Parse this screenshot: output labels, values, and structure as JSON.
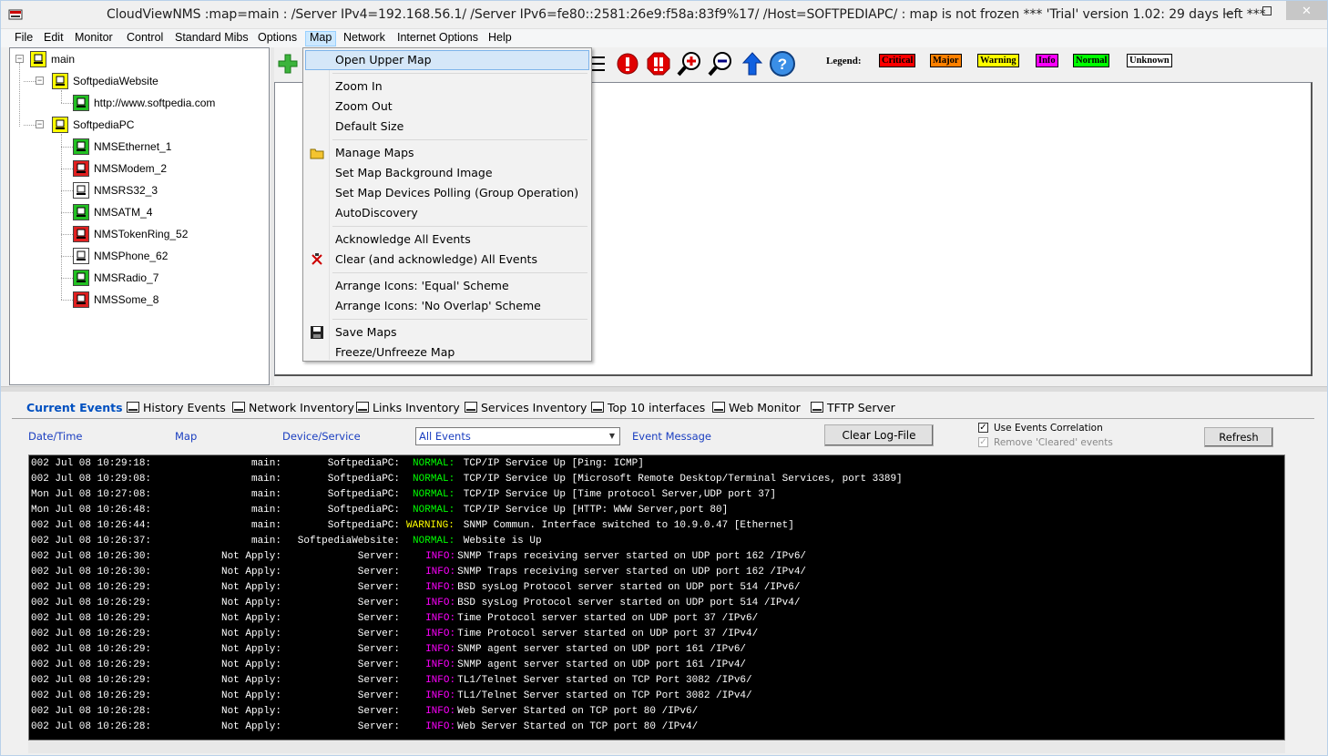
{
  "window": {
    "title": "CloudViewNMS :map=main :  /Server IPv4=192.168.56.1/ /Server IPv6=fe80::2581:26e9:f58a:83f9%17/ /Host=SOFTPEDIAPC/  : map is not frozen        *** 'Trial' version 1.02: 29 days left ***",
    "close_glyph": "✕"
  },
  "menubar": [
    "File",
    "Edit",
    "Monitor",
    "Control",
    "Standard Mibs",
    "Options",
    "Map",
    "Network",
    "Internet Options",
    "Help"
  ],
  "tree": {
    "root": "main",
    "groups": [
      {
        "label": "SoftpediaWebsite",
        "children": [
          {
            "label": "http://www.softpedia.com",
            "status": "normal"
          }
        ]
      },
      {
        "label": "SoftpediaPC",
        "children": [
          {
            "label": "NMSEthernet_1",
            "status": "normal"
          },
          {
            "label": "NMSModem_2",
            "status": "critical"
          },
          {
            "label": "NMSRS32_3",
            "status": "unknown"
          },
          {
            "label": "NMSATM_4",
            "status": "normal"
          },
          {
            "label": "NMSTokenRing_52",
            "status": "critical"
          },
          {
            "label": "NMSPhone_62",
            "status": "unknown"
          },
          {
            "label": "NMSRadio_7",
            "status": "normal"
          },
          {
            "label": "NMSSome_8",
            "status": "critical"
          }
        ]
      }
    ]
  },
  "legend": {
    "label": "Legend:",
    "items": [
      {
        "label": "Critical",
        "color": "#ff0000"
      },
      {
        "label": "Major",
        "color": "#ff8000"
      },
      {
        "label": "Warning",
        "color": "#ffff00"
      },
      {
        "label": "Info",
        "color": "#ff00ff"
      },
      {
        "label": "Normal",
        "color": "#00ff00"
      },
      {
        "label": "Unknown",
        "color": "#ffffff"
      }
    ]
  },
  "map_menu": {
    "items": [
      {
        "label": "Open Upper Map",
        "highlight": true
      },
      {
        "sep": true
      },
      {
        "label": "Zoom In"
      },
      {
        "label": "Zoom Out"
      },
      {
        "label": "Default Size"
      },
      {
        "sep": true
      },
      {
        "label": "Manage Maps",
        "icon": "folder-icon"
      },
      {
        "label": "Set Map Background Image"
      },
      {
        "label": "Set Map Devices Polling (Group Operation)"
      },
      {
        "label": "AutoDiscovery"
      },
      {
        "sep": true
      },
      {
        "label": "Acknowledge All Events"
      },
      {
        "label": "Clear (and acknowledge) All Events",
        "icon": "clear-events-icon"
      },
      {
        "sep": true
      },
      {
        "label": "Arrange Icons: 'Equal' Scheme"
      },
      {
        "label": "Arrange Icons: 'No Overlap' Scheme"
      },
      {
        "sep": true
      },
      {
        "label": "Save Maps",
        "icon": "floppy-icon"
      },
      {
        "label": "Freeze/Unfreeze Map"
      }
    ]
  },
  "tabs": [
    "Current Events",
    "History Events",
    "Network Inventory",
    "Links Inventory",
    "Services Inventory",
    "Top 10 interfaces",
    "Web Monitor",
    "TFTP Server"
  ],
  "events_panel": {
    "col_date": "Date/Time",
    "col_map": "Map",
    "col_device": "Device/Service",
    "col_message": "Event Message",
    "filter_value": "All Events",
    "clear_button": "Clear Log-File",
    "refresh_button": "Refresh",
    "use_correlation": "Use Events Correlation",
    "remove_cleared": "Remove 'Cleared' events"
  },
  "severity_colors": {
    "NORMAL": "#00ff00",
    "WARNING": "#ffff00",
    "INFO": "#ff00ff"
  },
  "log": [
    {
      "date": "002 Jul 08 10:29:18:",
      "map": "main:",
      "dev": "SoftpediaPC:",
      "sev": "NORMAL:",
      "msg": " TCP/IP Service Up [Ping: ICMP]"
    },
    {
      "date": "002 Jul 08 10:29:08:",
      "map": "main:",
      "dev": "SoftpediaPC:",
      "sev": "NORMAL:",
      "msg": " TCP/IP Service Up [Microsoft Remote Desktop/Terminal Services, port 3389]"
    },
    {
      "date": "Mon Jul 08 10:27:08:",
      "map": "main:",
      "dev": "SoftpediaPC:",
      "sev": "NORMAL:",
      "msg": " TCP/IP Service Up [Time protocol Server,UDP port 37]"
    },
    {
      "date": "Mon Jul 08 10:26:48:",
      "map": "main:",
      "dev": "SoftpediaPC:",
      "sev": "NORMAL:",
      "msg": " TCP/IP Service Up [HTTP: WWW Server,port 80]"
    },
    {
      "date": "002 Jul 08 10:26:44:",
      "map": "main:",
      "dev": "SoftpediaPC:",
      "sev": "WARNING:",
      "msg": " SNMP Commun. Interface switched to 10.9.0.47 [Ethernet]"
    },
    {
      "date": "002 Jul 08 10:26:37:",
      "map": "main:",
      "dev": "SoftpediaWebsite:",
      "sev": "NORMAL:",
      "msg": " Website is Up"
    },
    {
      "date": "002 Jul 08 10:26:30:",
      "map": "Not Apply:",
      "dev": "Server:",
      "sev": "INFO:",
      "msg": "SNMP Traps receiving server started on UDP port 162 /IPv6/"
    },
    {
      "date": "002 Jul 08 10:26:30:",
      "map": "Not Apply:",
      "dev": "Server:",
      "sev": "INFO:",
      "msg": "SNMP Traps receiving server started on UDP port 162 /IPv4/"
    },
    {
      "date": "002 Jul 08 10:26:29:",
      "map": "Not Apply:",
      "dev": "Server:",
      "sev": "INFO:",
      "msg": "BSD sysLog Protocol server started on UDP port 514 /IPv6/"
    },
    {
      "date": "002 Jul 08 10:26:29:",
      "map": "Not Apply:",
      "dev": "Server:",
      "sev": "INFO:",
      "msg": "BSD sysLog Protocol server started on UDP port 514 /IPv4/"
    },
    {
      "date": "002 Jul 08 10:26:29:",
      "map": "Not Apply:",
      "dev": "Server:",
      "sev": "INFO:",
      "msg": "Time Protocol server started on UDP port 37 /IPv6/"
    },
    {
      "date": "002 Jul 08 10:26:29:",
      "map": "Not Apply:",
      "dev": "Server:",
      "sev": "INFO:",
      "msg": "Time Protocol server started on UDP port 37 /IPv4/"
    },
    {
      "date": "002 Jul 08 10:26:29:",
      "map": "Not Apply:",
      "dev": "Server:",
      "sev": "INFO:",
      "msg": "SNMP agent server started on UDP port 161 /IPv6/"
    },
    {
      "date": "002 Jul 08 10:26:29:",
      "map": "Not Apply:",
      "dev": "Server:",
      "sev": "INFO:",
      "msg": "SNMP agent server started on UDP port 161 /IPv4/"
    },
    {
      "date": "002 Jul 08 10:26:29:",
      "map": "Not Apply:",
      "dev": "Server:",
      "sev": "INFO:",
      "msg": "TL1/Telnet Server started on TCP Port 3082 /IPv6/"
    },
    {
      "date": "002 Jul 08 10:26:29:",
      "map": "Not Apply:",
      "dev": "Server:",
      "sev": "INFO:",
      "msg": "TL1/Telnet Server started on TCP Port 3082 /IPv4/"
    },
    {
      "date": "002 Jul 08 10:26:28:",
      "map": "Not Apply:",
      "dev": "Server:",
      "sev": "INFO:",
      "msg": "Web Server Started on TCP port 80 /IPv6/"
    },
    {
      "date": "002 Jul 08 10:26:28:",
      "map": "Not Apply:",
      "dev": "Server:",
      "sev": "INFO:",
      "msg": "Web Server Started on TCP port 80 /IPv4/"
    }
  ]
}
